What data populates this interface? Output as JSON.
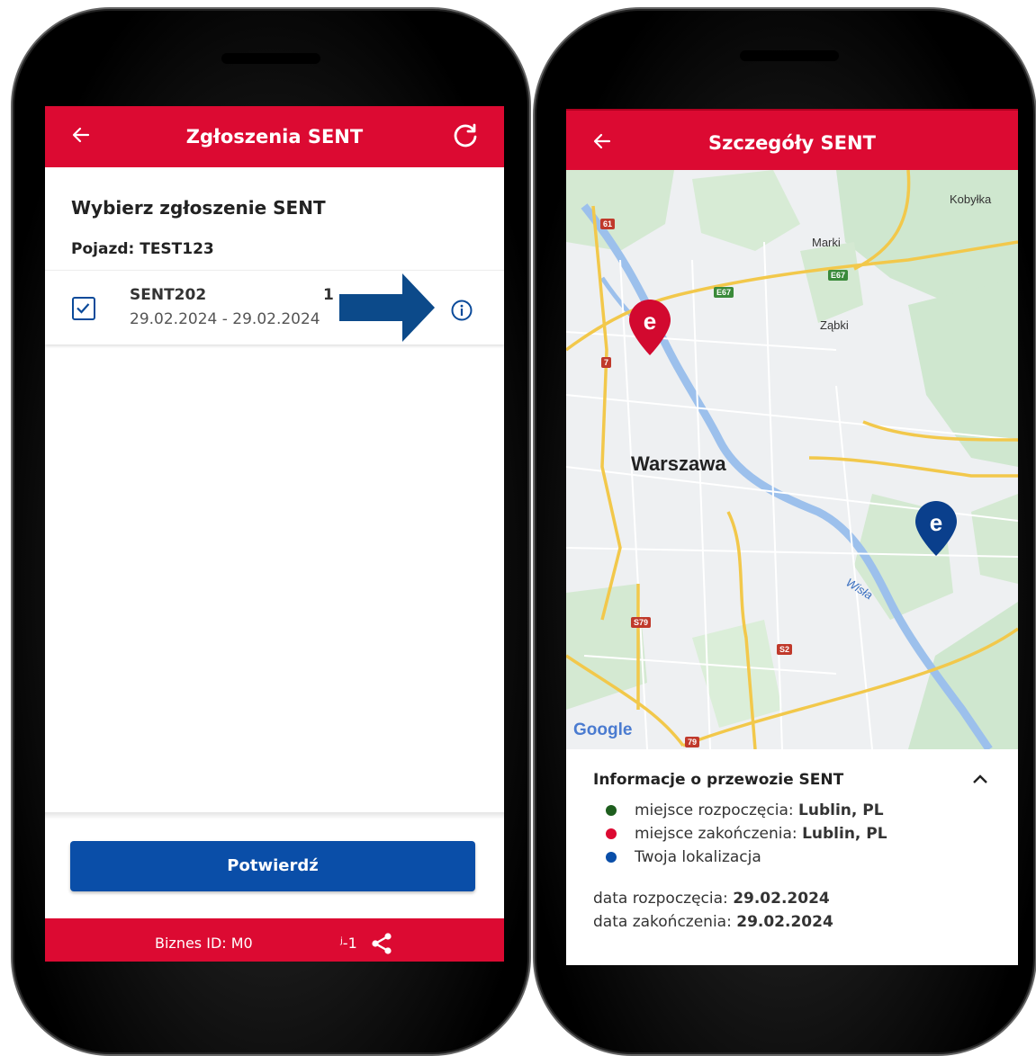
{
  "colors": {
    "brand_red": "#dc0a32",
    "primary_blue": "#0a4ea8",
    "start_dot": "#1e5e1e",
    "end_dot": "#dc0a32",
    "location_dot": "#0a4ea8"
  },
  "left_screen": {
    "app_bar": {
      "title": "Zgłoszenia SENT",
      "back_icon": "arrow-left-icon",
      "refresh_icon": "refresh-icon"
    },
    "heading": "Wybierz zgłoszenie SENT",
    "vehicle_label": "Pojazd: TEST123",
    "list": [
      {
        "id": "SENT202",
        "id_tail": "1",
        "dates": "29.02.2024 - 29.02.2024",
        "checked": true
      }
    ],
    "info_icon": "info-icon",
    "confirm_label": "Potwierdź",
    "footer": {
      "business_id_prefix": "Biznes ID:  M0",
      "business_id_suffix": "ʲ-1",
      "share_icon": "share-icon"
    }
  },
  "right_screen": {
    "app_bar": {
      "title": "Szczegóły SENT",
      "back_icon": "arrow-left-icon"
    },
    "map": {
      "city_label": "Warszawa",
      "place_labels": [
        "Kobyłka",
        "Marki",
        "Ząbki",
        "Wisła"
      ],
      "road_labels": [
        "61",
        "7",
        "E67",
        "E67",
        "S79",
        "S2",
        "79"
      ],
      "provider": "Google"
    },
    "info_panel": {
      "title": "Informacje o przewozie SENT",
      "collapse_icon": "chevron-up-icon",
      "legend": [
        {
          "label": "miejsce rozpoczęcia: ",
          "value": "Lublin, PL",
          "color": "#1e5e1e"
        },
        {
          "label": "miejsce zakończenia: ",
          "value": "Lublin, PL",
          "color": "#dc0a32"
        },
        {
          "label": "Twoja lokalizacja",
          "value": "",
          "color": "#0a4ea8"
        }
      ],
      "start_date_label": "data rozpoczęcia: ",
      "start_date": "29.02.2024",
      "end_date_label": "data zakończenia: ",
      "end_date": "29.02.2024"
    }
  }
}
